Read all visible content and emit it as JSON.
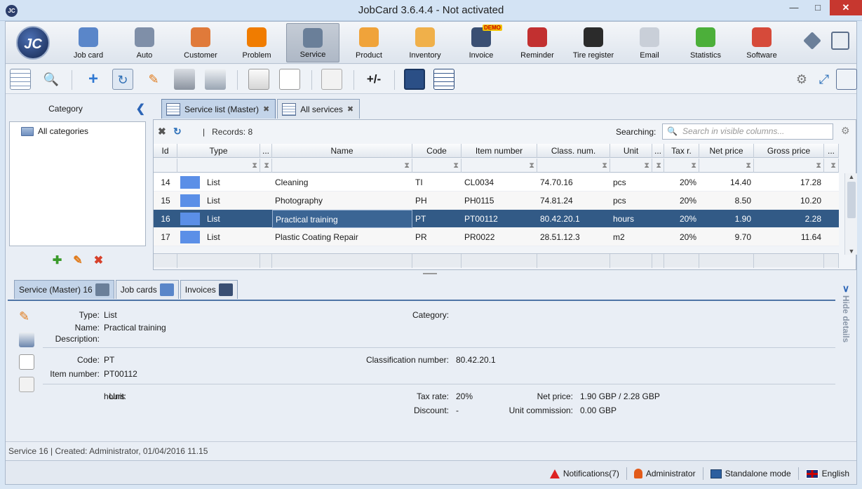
{
  "window": {
    "title": "JobCard 3.6.4.4 - Not activated",
    "app_icon": "JC"
  },
  "logo": {
    "text": "JC"
  },
  "modules": [
    {
      "label": "Job card",
      "icon": "job-card-icon",
      "color": "#5a86c9"
    },
    {
      "label": "Auto",
      "icon": "gear-icon",
      "color": "#7f8fa8"
    },
    {
      "label": "Customer",
      "icon": "customer-icon",
      "color": "#e07a3a"
    },
    {
      "label": "Problem",
      "icon": "warning-icon",
      "color": "#f07c00"
    },
    {
      "label": "Service",
      "icon": "tools-icon",
      "color": "#6a7f99",
      "active": true
    },
    {
      "label": "Product",
      "icon": "box-icon",
      "color": "#f0a33a"
    },
    {
      "label": "Inventory",
      "icon": "boxes-icon",
      "color": "#f0b04a"
    },
    {
      "label": "Invoice",
      "icon": "invoice-icon",
      "color": "#3a4f73",
      "badge": "DEMO"
    },
    {
      "label": "Reminder",
      "icon": "clock-icon",
      "color": "#c23030"
    },
    {
      "label": "Tire register",
      "icon": "tire-icon",
      "color": "#2b2b2b"
    },
    {
      "label": "Email",
      "icon": "envelope-icon",
      "color": "#c9cfd8"
    },
    {
      "label": "Statistics",
      "icon": "pie-chart-icon",
      "color": "#4caf3a"
    },
    {
      "label": "Software",
      "icon": "windows-icon",
      "color": "#d64a3a"
    }
  ],
  "category": {
    "title": "Category",
    "items": [
      "All categories"
    ]
  },
  "tabs": [
    {
      "label": "Service list (Master)",
      "active": true
    },
    {
      "label": "All services",
      "active": false
    }
  ],
  "list": {
    "records": "Records: 8",
    "search_label": "Searching:",
    "search_placeholder": "Search in visible columns...",
    "columns": [
      "Id",
      "Type",
      "...",
      "Name",
      "Code",
      "Item number",
      "Class. num.",
      "Unit",
      "...",
      "Tax r.",
      "Net price",
      "Gross price",
      "..."
    ],
    "rows": [
      {
        "id": "14",
        "type": "List",
        "name": "Cleaning",
        "code": "TI",
        "item": "CL0034",
        "class": "74.70.16",
        "unit": "pcs",
        "tax": "20%",
        "net": "14.40",
        "gross": "17.28",
        "selected": false
      },
      {
        "id": "15",
        "type": "List",
        "name": "Photography",
        "code": "PH",
        "item": "PH0115",
        "class": "74.81.24",
        "unit": "pcs",
        "tax": "20%",
        "net": "8.50",
        "gross": "10.20",
        "selected": false
      },
      {
        "id": "16",
        "type": "List",
        "name": "Practical training",
        "code": "PT",
        "item": "PT00112",
        "class": "80.42.20.1",
        "unit": "hours",
        "tax": "20%",
        "net": "1.90",
        "gross": "2.28",
        "selected": true
      },
      {
        "id": "17",
        "type": "List",
        "name": "Plastic Coating Repair",
        "code": "PR",
        "item": "PR0022",
        "class": "28.51.12.3",
        "unit": "m2",
        "tax": "20%",
        "net": "9.70",
        "gross": "11.64",
        "selected": false
      }
    ],
    "swatch_color": "#5b8fe7"
  },
  "detail_tabs": [
    {
      "label": "Service (Master) 16",
      "active": true
    },
    {
      "label": "Job cards",
      "active": false
    },
    {
      "label": "Invoices",
      "active": false
    }
  ],
  "details": {
    "type_label": "Type:",
    "type_value": "List",
    "name_label": "Name:",
    "name_value": "Practical training",
    "description_label": "Description:",
    "category_label": "Category:",
    "code_label": "Code:",
    "code_value": "PT",
    "item_label": "Item number:",
    "item_value": "PT00112",
    "classification_label": "Classification number:",
    "classification_value": "80.42.20.1",
    "unit_label": "Unit:",
    "unit_value": "hours",
    "tax_label": "Tax rate:",
    "tax_value": "20%",
    "net_label": "Net price:",
    "net_value": "1.90 GBP / 2.28 GBP",
    "discount_label": "Discount:",
    "discount_value": "-",
    "commission_label": "Unit commission:",
    "commission_value": "0.00 GBP",
    "hide_label": "Hide details"
  },
  "status": {
    "line": "Service 16 | Created: Administrator, 01/04/2016 11.15",
    "notifications": "Notifications(7)",
    "user": "Administrator",
    "mode": "Standalone mode",
    "language": "English"
  }
}
